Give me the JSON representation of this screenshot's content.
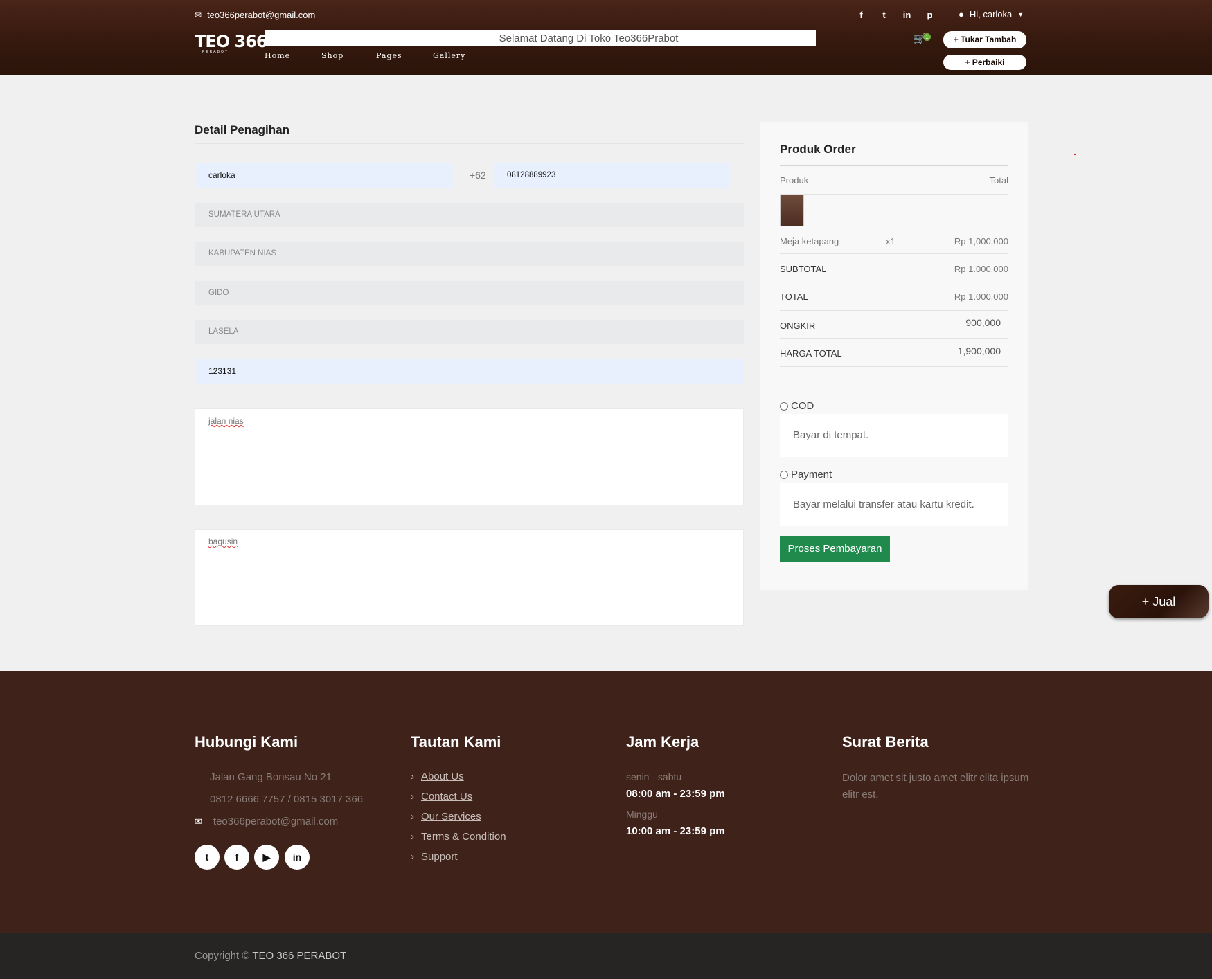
{
  "header": {
    "email": "teo366perabot@gmail.com",
    "logo": "TEO 366",
    "logo_sub": "PERABOT",
    "marquee": "Selamat Datang Di Toko Teo366Prabot",
    "nav": [
      "Home",
      "Shop",
      "Pages",
      "Gallery"
    ],
    "user": "Hi, carloka",
    "cart_count": "1",
    "tukar_label": "+ Tukar Tambah",
    "perbaiki_label": "+ Perbaiki",
    "socials": [
      "f",
      "t",
      "in",
      "p"
    ]
  },
  "billing": {
    "title": "Detail Penagihan",
    "name": "carloka",
    "phone_code": "+62",
    "phone": "08128889923",
    "province": "SUMATERA UTARA",
    "regency": "KABUPATEN NIAS",
    "district": "GIDO",
    "village": "LASELA",
    "postal": "123131",
    "address": "jalan nias",
    "notes": "bagusin"
  },
  "order": {
    "title": "Produk Order",
    "col_product": "Produk",
    "col_total": "Total",
    "item_name": "Meja ketapang",
    "item_qty": "x1",
    "item_price": "Rp 1,000,000",
    "subtotal_label": "SUBTOTAL",
    "subtotal": "Rp 1.000.000",
    "total_label": "TOTAL",
    "total": "Rp 1.000.000",
    "ongkir_label": "ONGKIR",
    "ongkir": "900,000",
    "harga_label": "HARGA TOTAL",
    "harga": "1,900,000",
    "cod_label": "COD",
    "cod_desc": "Bayar di tempat.",
    "payment_label": "Payment",
    "payment_desc": "Bayar melalui transfer atau kartu kredit.",
    "submit": "Proses Pembayaran"
  },
  "jual_label": "+ Jual",
  "footer": {
    "contact_title": "Hubungi Kami",
    "address": "Jalan Gang Bonsau No 21",
    "phones": "0812 6666 7757 / 0815 3017 366",
    "email": "teo366perabot@gmail.com",
    "links_title": "Tautan Kami",
    "links": [
      "About Us",
      "Contact Us",
      "Our Services",
      "Terms & Condition",
      "Support"
    ],
    "hours_title": "Jam Kerja",
    "days1": "senin - sabtu",
    "hours1": "08:00 am - 23:59 pm",
    "days2": "Minggu",
    "hours2": "10:00 am - 23:59 pm",
    "news_title": "Surat Berita",
    "news_text": "Dolor amet sit justo amet elitr clita ipsum elitr est.",
    "socials": [
      "twitter-icon",
      "facebook-icon",
      "youtube-icon",
      "linkedin-icon"
    ],
    "copyright_prefix": "Copyright ©",
    "copyright_brand": "TEO 366 PERABOT"
  }
}
